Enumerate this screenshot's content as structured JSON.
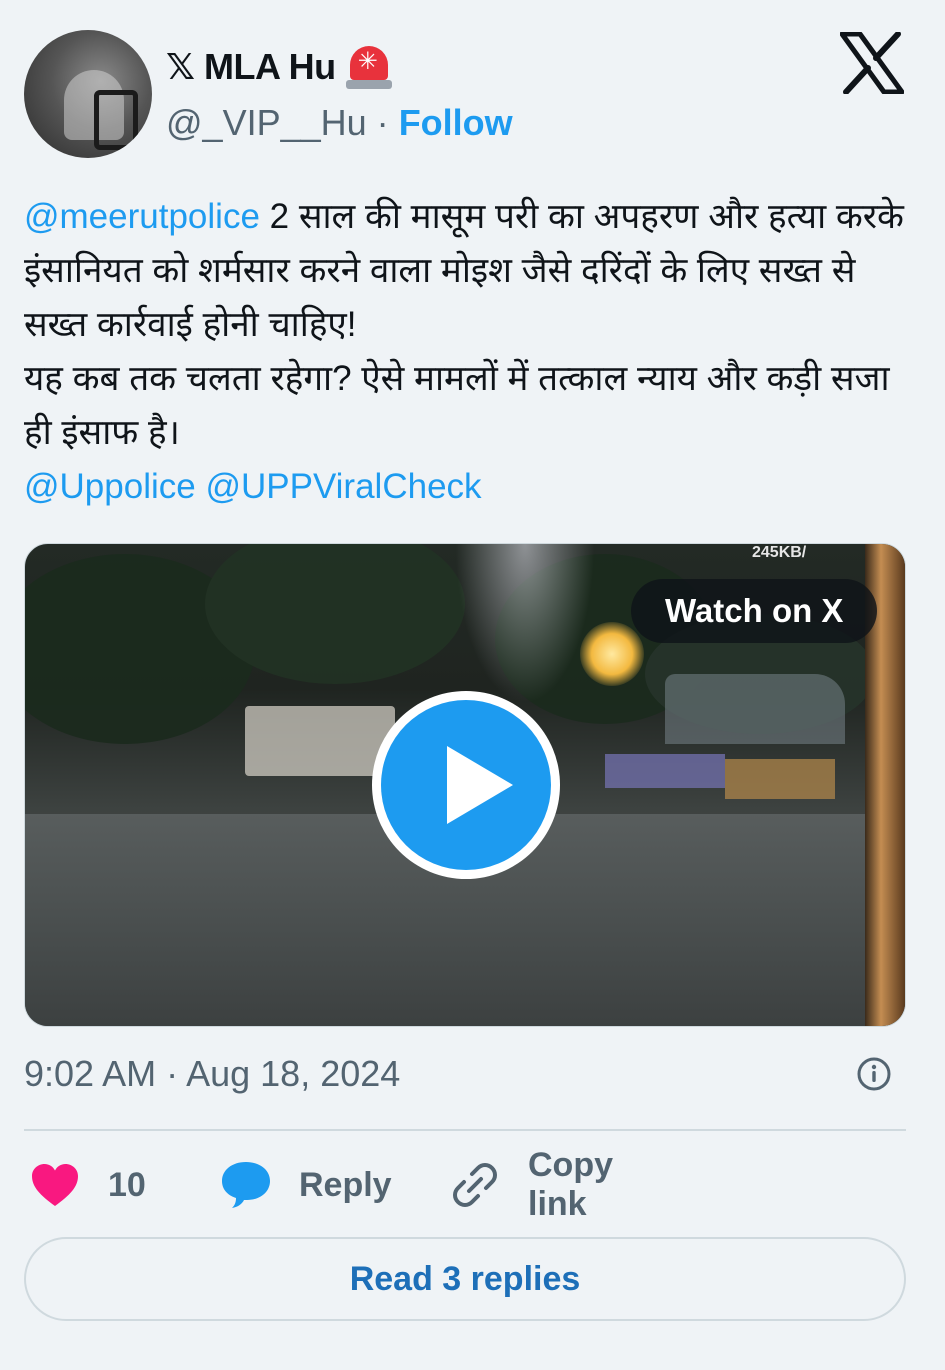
{
  "author": {
    "display_name": "𝕏 MLA Hu",
    "handle": "@_VIP__Hu",
    "separator": "·",
    "follow_label": "Follow"
  },
  "tweet": {
    "lines": [
      {
        "mention": "@meerutpolice",
        "text": " 2 साल की मासूम परी का अपहरण और हत्या करके इंसानियत को शर्मसार करने वाला मोइश जैसे दरिंदों के लिए सख्त से सख्त कार्रवाई होनी चाहिए!"
      },
      {
        "text": "यह कब तक चलता रहेगा? ऐसे मामलों में तत्काल न्याय और कड़ी सजा ही इंसाफ है।"
      }
    ],
    "mentions_line": [
      "@Uppolice",
      "@UPPViralCheck"
    ]
  },
  "media": {
    "watch_label": "Watch on X",
    "overlay_text": "245KB/"
  },
  "timestamp": "9:02 AM · Aug 18, 2024",
  "actions": {
    "likes_count": "10",
    "reply_label": "Reply",
    "copy_label": "Copy link"
  },
  "read_replies_label": "Read 3 replies",
  "colors": {
    "accent": "#1d9bf0",
    "heart": "#f91880",
    "muted": "#536471"
  }
}
